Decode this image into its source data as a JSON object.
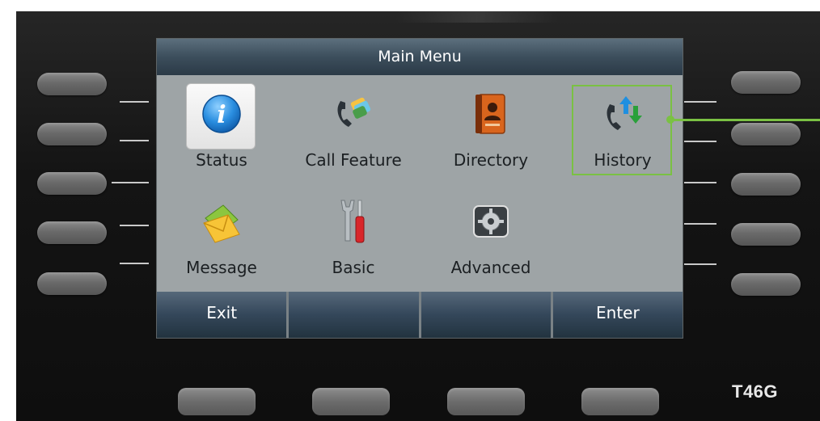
{
  "screen": {
    "title": "Main Menu"
  },
  "menu": {
    "items": [
      {
        "label": "Status",
        "icon": "info-icon"
      },
      {
        "label": "Call Feature",
        "icon": "call-feature-icon"
      },
      {
        "label": "Directory",
        "icon": "directory-book-icon"
      },
      {
        "label": "History",
        "icon": "call-history-icon"
      },
      {
        "label": "Message",
        "icon": "envelope-icon"
      },
      {
        "label": "Basic",
        "icon": "tools-icon"
      },
      {
        "label": "Advanced",
        "icon": "gear-icon"
      }
    ],
    "selected": "Status",
    "highlighted": "History"
  },
  "softkeys": [
    "Exit",
    "",
    "",
    "Enter"
  ],
  "device": {
    "model": "T46G"
  },
  "colors": {
    "screen_bg": "#9ea4a6",
    "titlebar": "#3c4e5c",
    "highlight": "#7ac143"
  }
}
